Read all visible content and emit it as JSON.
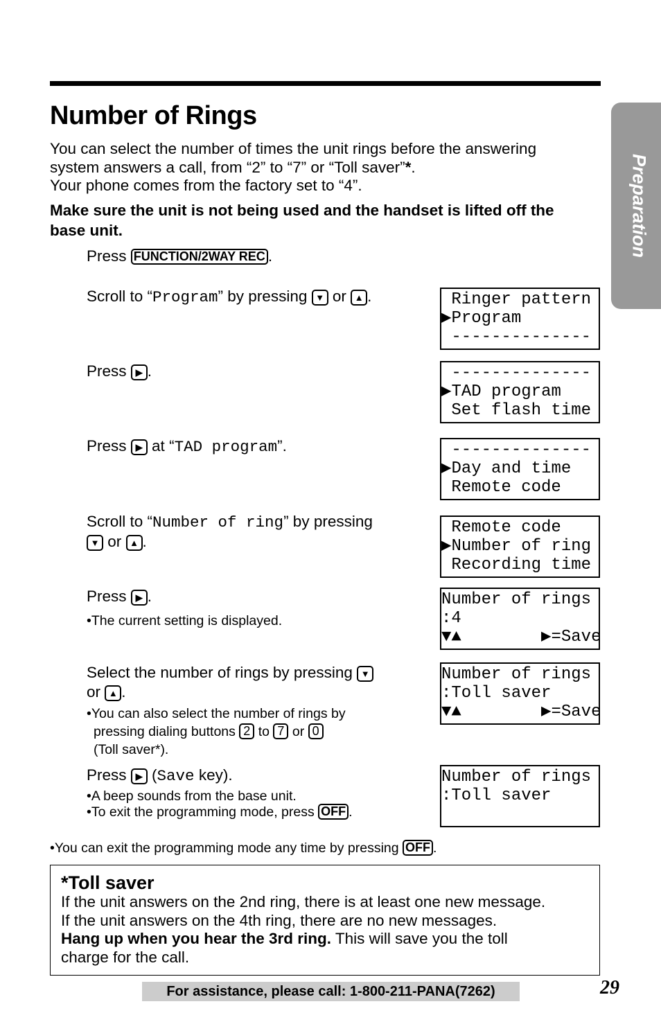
{
  "side_tab": "Preparation",
  "title": "Number of Rings",
  "intro": {
    "line1": "You can select the number of times the unit rings before the answering",
    "line2": "system answers a call, from “2” to “7” or “Toll saver”",
    "star": "*",
    "line2_end": ".",
    "line3": "Your phone comes from the factory set to “4”."
  },
  "warning": {
    "line1": "Make sure the unit is not being used and the handset is lifted off the",
    "line2": "base unit."
  },
  "keys": {
    "function": "FUNCTION/2WAY REC",
    "down": "▼",
    "up": "▲",
    "right": "▶",
    "k2": "2",
    "k7": "7",
    "k0": "0",
    "off": "OFF"
  },
  "steps": {
    "s1": {
      "press": "Press",
      "end": "."
    },
    "s2": {
      "a": "Scroll to “",
      "mono": "Program",
      "b": "” by pressing",
      "or": "or",
      "end": "."
    },
    "s3": {
      "press": "Press",
      "end": "."
    },
    "s4": {
      "press": "Press",
      "b": "at “",
      "mono": "TAD program",
      "end": "”."
    },
    "s5": {
      "a": "Scroll to “",
      "mono": "Number of ring",
      "b": "” by pressing",
      "or": "or",
      "end": "."
    },
    "s6": {
      "press": "Press",
      "end": ".",
      "note": "•The current setting is displayed."
    },
    "s7": {
      "a": "Select the number of rings by pressing",
      "or": "or",
      "end": ".",
      "note1": "•You can also select the number of rings by",
      "note2a": "pressing dialing buttons",
      "to": "to",
      "or2": "or",
      "note3": "(Toll saver*)."
    },
    "s8": {
      "press": "Press",
      "b": "(",
      "mono": "Save",
      "c": " key).",
      "note1": "•A beep sounds from the base unit.",
      "note2": "•To exit the programming mode, press",
      "end": "."
    }
  },
  "displays": [
    [
      " Ringer pattern",
      "▶Program",
      " --------------"
    ],
    [
      " --------------",
      "▶TAD program",
      " Set flash time"
    ],
    [
      " --------------",
      "▶Day and time",
      " Remote code"
    ],
    [
      " Remote code",
      "▶Number of ring",
      " Recording time"
    ],
    [
      "Number of rings",
      ":4",
      "▼▲        ▶=Save"
    ],
    [
      "Number of rings",
      ":Toll saver",
      "▼▲        ▶=Save"
    ],
    [
      "Number of rings",
      ":Toll saver",
      ""
    ]
  ],
  "exit_note": "•You can exit the programming mode any time by pressing",
  "exit_end": ".",
  "toll_saver": {
    "heading": "*Toll saver",
    "line1": "If the unit answers on the 2nd ring, there is at least one new message.",
    "line2": "If the unit answers on the 4th ring, there are no new messages.",
    "bold": "Hang up when you hear the 3rd ring.",
    "rest": " This will save you the toll",
    "line4": "charge for the call."
  },
  "footer": "For assistance, please call: 1-800-211-PANA(7262)",
  "page_number": "29"
}
